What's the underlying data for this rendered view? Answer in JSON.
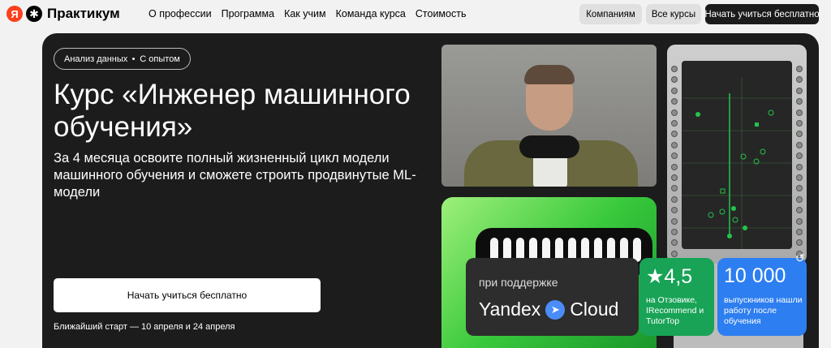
{
  "header": {
    "logo_ya": "Я",
    "logo_star": "✱",
    "logo_text": "Практикум",
    "nav": [
      "О профессии",
      "Программа",
      "Как учим",
      "Команда курса",
      "Стоимость"
    ],
    "companies_label": "Компаниям",
    "all_courses_label": "Все курсы",
    "start_label": "Начать учиться бесплатно"
  },
  "hero": {
    "tag_1": "Анализ данных",
    "tag_2": "С опытом",
    "title": "Курс «Инженер машинного обучения»",
    "subtitle": "За 4 месяца освоите полный жизненный цикл модели машинного обучения и сможете строить продвинутые ML-модели",
    "cta_label": "Начать учиться бесплатно",
    "nearest_start": "Ближайший старт — 10 апреля и 24 апреля"
  },
  "cards": {
    "cloud_support": "при поддержке",
    "cloud_brand_1": "Yandex",
    "cloud_brand_2": "Cloud",
    "rating_value": "★4,5",
    "rating_desc": "на Отзовике, IRecommend и TutorTop",
    "grads_value": "10 000",
    "grads_desc": "выпускников нашли работу после обучения"
  },
  "colors": {
    "accent_green": "#18a356",
    "accent_blue": "#2d7ef0",
    "hero_bg": "#1c1c1c"
  },
  "icons": {
    "compass": "compass-icon",
    "reload": "reload-icon"
  }
}
